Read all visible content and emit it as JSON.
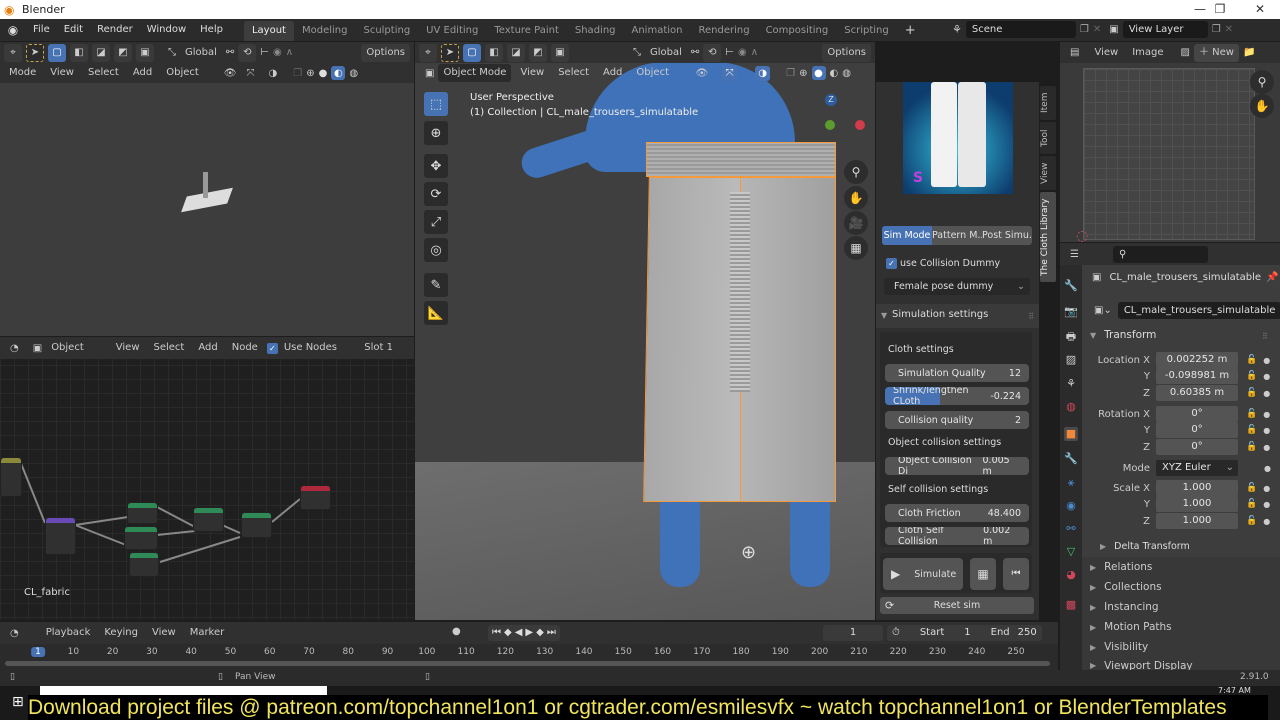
{
  "window": {
    "title": "Blender",
    "minimize": "—",
    "maximize": "❐",
    "close": "✕"
  },
  "menu": [
    "File",
    "Edit",
    "Render",
    "Window",
    "Help"
  ],
  "workspaces": [
    "Layout",
    "Modeling",
    "Sculpting",
    "UV Editing",
    "Texture Paint",
    "Shading",
    "Animation",
    "Rendering",
    "Compositing",
    "Scripting",
    "+"
  ],
  "active_workspace": "Layout",
  "scene": {
    "label": "Scene",
    "view_layer": "View Layer"
  },
  "left_viewport": {
    "transform": "Global",
    "options": "Options",
    "mode": "Mode",
    "menus": [
      "View",
      "Select",
      "Add",
      "Object"
    ]
  },
  "shader_editor": {
    "object": "Object",
    "menus": [
      "View",
      "Select",
      "Add",
      "Node"
    ],
    "use_nodes": "Use Nodes",
    "use_nodes_checked": true,
    "slot": "Slot 1",
    "material_name": "CL_fabric"
  },
  "main_viewport": {
    "transform": "Global",
    "options": "Options",
    "mode": "Object Mode",
    "menus": [
      "View",
      "Select",
      "Add",
      "Object"
    ],
    "perspective": "User Perspective",
    "collection": "(1) Collection | CL_male_trousers_simulatable",
    "gizmo_axis": "Z"
  },
  "cloth_panel": {
    "tabs": [
      "Sim Mode",
      "Pattern M...",
      "Post Simu..."
    ],
    "active_tab": "Sim Mode",
    "use_collision_dummy": {
      "label": "use Collision Dummy",
      "checked": true
    },
    "dummy_select": "Female pose dummy",
    "section_title": "Simulation settings",
    "cloth_settings_label": "Cloth settings",
    "simulation_quality": {
      "label": "Simulation Quality",
      "value": "12"
    },
    "shrink": {
      "label": "Shrink/lengthen CLoth",
      "value": "-0.224",
      "fill_fraction": 0.38
    },
    "collision_quality": {
      "label": "Collision quality",
      "value": "2"
    },
    "object_collision_label": "Object collision settings",
    "object_collision_distance": {
      "label": "Object Collision Di",
      "value": "0.005 m"
    },
    "self_collision_label": "Self collision settings",
    "cloth_friction": {
      "label": "Cloth Friction",
      "value": "48.400"
    },
    "cloth_self_collision": {
      "label": "Cloth Self Collision",
      "value": "0.002 m"
    },
    "simulate": "Simulate",
    "reset": "Reset  sim"
  },
  "sidebar_tabs": [
    "Item",
    "Tool",
    "View",
    "The Cloth Library"
  ],
  "image_editor": {
    "menus": [
      "View",
      "Image"
    ],
    "new": "New"
  },
  "properties": {
    "object_name": "CL_male_trousers_simulatable",
    "data_name": "CL_male_trousers_simulatable",
    "transform_title": "Transform",
    "location": {
      "label": "Location X",
      "x": "0.002252 m",
      "y": "-0.098981 m",
      "z": "0.60385 m"
    },
    "rotation": {
      "label": "Rotation X",
      "x": "0°",
      "y": "0°",
      "z": "0°"
    },
    "mode": {
      "label": "Mode",
      "value": "XYZ Euler"
    },
    "scale": {
      "label": "Scale X",
      "x": "1.000",
      "y": "1.000",
      "z": "1.000"
    },
    "axis_y": "Y",
    "axis_z": "Z",
    "delta": "Delta Transform",
    "sections": [
      "Relations",
      "Collections",
      "Instancing",
      "Motion Paths",
      "Visibility",
      "Viewport Display"
    ]
  },
  "timeline": {
    "menus": [
      "Playback",
      "Keying",
      "View",
      "Marker"
    ],
    "current_frame": "1",
    "start_label": "Start",
    "start": "1",
    "end_label": "End",
    "end": "250",
    "ticks": [
      "1",
      "10",
      "20",
      "30",
      "40",
      "50",
      "60",
      "70",
      "80",
      "90",
      "100",
      "110",
      "120",
      "130",
      "140",
      "150",
      "160",
      "170",
      "180",
      "190",
      "200",
      "210",
      "220",
      "230",
      "240",
      "250"
    ]
  },
  "status": {
    "pan": "Pan View",
    "version": "2.91.0",
    "clock": "7:47 AM"
  },
  "banner": "Download project files @ patreon.com/topchannel1on1 or cgtrader.com/esmilesvfx  ~ watch topchannel1on1 or BlenderTemplates"
}
